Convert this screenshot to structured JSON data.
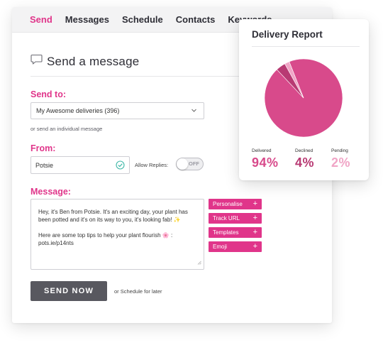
{
  "tabs": [
    "Send",
    "Messages",
    "Schedule",
    "Contacts",
    "Keywords"
  ],
  "active_tab": "Send",
  "heading": {
    "title": "Send a message",
    "icon": "speech-bubble-icon"
  },
  "send_to": {
    "label": "Send to:",
    "selected": "My Awesome deliveries (396)",
    "alt_link": "or send an individual message"
  },
  "from": {
    "label": "From:",
    "value": "Potsie",
    "allow_replies_label": "Allow Replies:",
    "toggle_state": "OFF"
  },
  "message": {
    "label": "Message:",
    "paragraph1": "Hey, it's Ben from Potsie. It's an exciting day, your plant has been potted and it's on its way to you, it's looking fab! ✨",
    "paragraph2": "Here are some top tips to help your plant flourish 🌸 : pots.ie/p14nts"
  },
  "actions": [
    {
      "label": "Personalise",
      "icon": "plus-icon"
    },
    {
      "label": "Track URL",
      "icon": "plus-icon"
    },
    {
      "label": "Templates",
      "icon": "plus-icon"
    },
    {
      "label": "Emoji",
      "icon": "plus-icon"
    }
  ],
  "send_button": "SEND NOW",
  "schedule_link": "or Schedule for later",
  "report": {
    "title": "Delivery Report",
    "stats": [
      {
        "label": "Delivered",
        "value": "94%",
        "color": "#d84a8b"
      },
      {
        "label": "Declined",
        "value": "4%",
        "color": "#b83a73"
      },
      {
        "label": "Pending",
        "value": "2%",
        "color": "#f0a5c6"
      }
    ]
  },
  "chart_data": {
    "type": "pie",
    "categories": [
      "Delivered",
      "Declined",
      "Pending"
    ],
    "values": [
      94,
      4,
      2
    ],
    "colors": [
      "#d84a8b",
      "#b83a73",
      "#f0a5c6"
    ]
  },
  "colors": {
    "accent": "#e0358a",
    "button": "#58585f"
  }
}
